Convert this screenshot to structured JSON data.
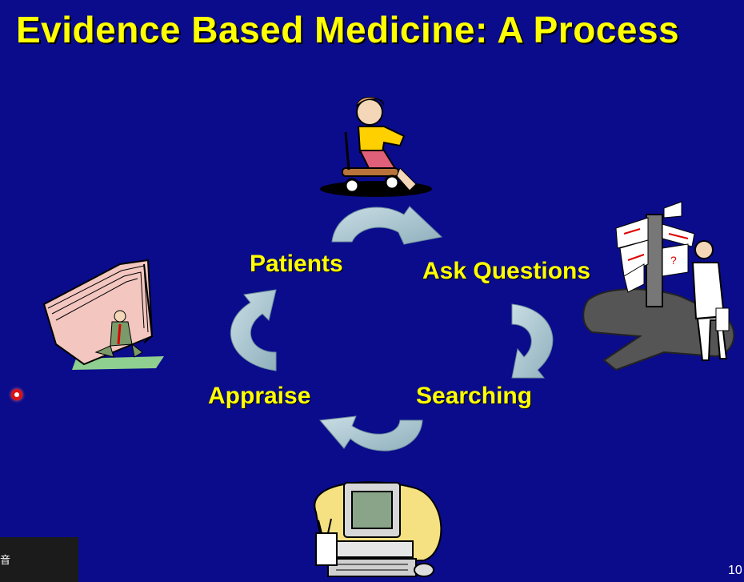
{
  "slide": {
    "title": "Evidence Based Medicine: A Process",
    "cycle": {
      "patients": "Patients",
      "ask": "Ask Questions",
      "searching": "Searching",
      "appraise": "Appraise"
    },
    "page_number": "10",
    "corner_text": "音"
  },
  "colors": {
    "background": "#0a0c8c",
    "title": "#ffff00",
    "labels": "#ffff00",
    "arrows": "#a6c2cc"
  },
  "icons": [
    "child-scooter-icon",
    "signpost-man-icon",
    "computer-icon",
    "file-folder-icon"
  ]
}
